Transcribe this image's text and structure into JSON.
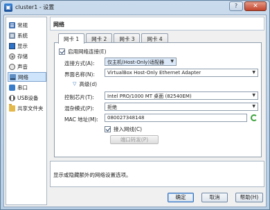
{
  "window": {
    "title": "cluster1 - 设置"
  },
  "sidebar": {
    "items": [
      {
        "label": "常规",
        "icon": "general-icon"
      },
      {
        "label": "系统",
        "icon": "system-icon"
      },
      {
        "label": "显示",
        "icon": "display-icon"
      },
      {
        "label": "存储",
        "icon": "storage-icon"
      },
      {
        "label": "声音",
        "icon": "audio-icon"
      },
      {
        "label": "网络",
        "icon": "network-icon",
        "selected": true
      },
      {
        "label": "串口",
        "icon": "serial-icon"
      },
      {
        "label": "USB设备",
        "icon": "usb-icon"
      },
      {
        "label": "共享文件夹",
        "icon": "shared-folder-icon"
      }
    ]
  },
  "section": {
    "title": "网络"
  },
  "tabs": [
    "网卡 1",
    "网卡 2",
    "网卡 3",
    "网卡 4"
  ],
  "adapter": {
    "enable_label": "启用网络连接(E)",
    "attach_label": "连接方式(A):",
    "attach_value": "仅主机(Host-Only)适配器",
    "name_label": "界面名称(N):",
    "name_value": "VirtualBox Host-Only Ethernet Adapter",
    "advanced_label": "高级(d)",
    "chip_label": "控制芯片(T):",
    "chip_value": "Intel PRO/1000 MT 桌面 (82540EM)",
    "promisc_label": "混杂模式(P):",
    "promisc_value": "拒绝",
    "mac_label": "MAC 地址(M):",
    "mac_value": "080027348148",
    "cable_label": "接入网线(C)",
    "port_forward_label": "端口转发(P)"
  },
  "info": {
    "text": "显示或隐藏额外的网络设置选项。"
  },
  "buttons": {
    "ok": "确定",
    "cancel": "取消",
    "help": "帮助(H)"
  },
  "titlebar": {
    "help_glyph": "?",
    "close_glyph": "✕"
  }
}
